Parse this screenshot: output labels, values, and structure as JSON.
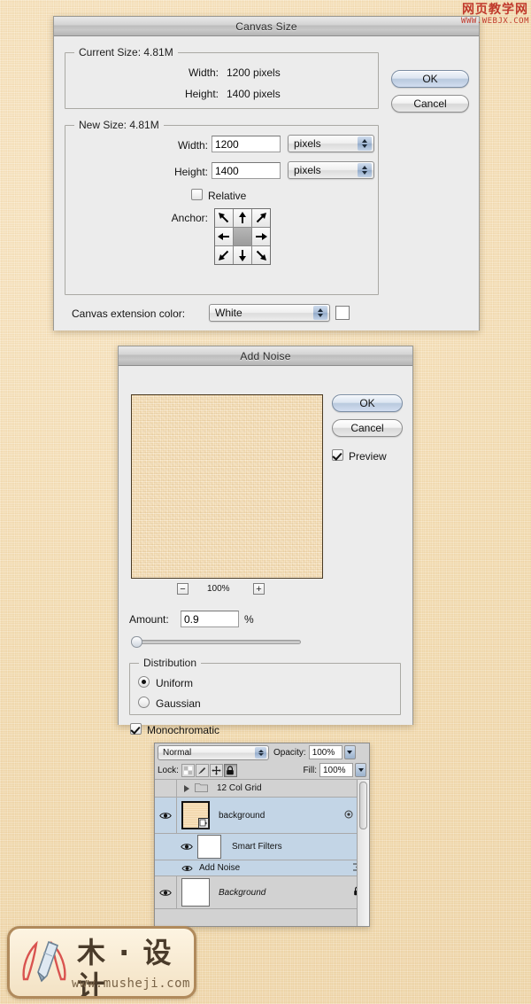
{
  "canvas_size_dialog": {
    "title": "Canvas Size",
    "current_size": {
      "legend": "Current Size: 4.81M",
      "width_label": "Width:",
      "width_value": "1200 pixels",
      "height_label": "Height:",
      "height_value": "1400 pixels"
    },
    "new_size": {
      "legend": "New Size: 4.81M",
      "width_label": "Width:",
      "width_value": "1200",
      "width_unit": "pixels",
      "height_label": "Height:",
      "height_value": "1400",
      "height_unit": "pixels",
      "relative_label": "Relative",
      "relative_checked": false,
      "anchor_label": "Anchor:"
    },
    "extension_color_label": "Canvas extension color:",
    "extension_color_value": "White",
    "extension_swatch_color": "#ffffff",
    "ok_label": "OK",
    "cancel_label": "Cancel"
  },
  "add_noise_dialog": {
    "title": "Add Noise",
    "ok_label": "OK",
    "cancel_label": "Cancel",
    "preview_label": "Preview",
    "preview_checked": true,
    "zoom_out_label": "−",
    "zoom_level": "100%",
    "zoom_in_label": "+",
    "amount_label": "Amount:",
    "amount_value": "0.9",
    "amount_unit": "%",
    "distribution_legend": "Distribution",
    "uniform_label": "Uniform",
    "uniform_selected": true,
    "gaussian_label": "Gaussian",
    "gaussian_selected": false,
    "monochromatic_label": "Monochromatic",
    "monochromatic_checked": true,
    "preview_swatch_color": "#f7dfb4"
  },
  "layers_panel": {
    "blend_mode": "Normal",
    "opacity_label": "Opacity:",
    "opacity_value": "100%",
    "lock_label": "Lock:",
    "fill_label": "Fill:",
    "fill_value": "100%",
    "lock_icons": [
      {
        "name": "lock-transparency-icon",
        "active": false
      },
      {
        "name": "lock-image-pixels-icon",
        "active": false
      },
      {
        "name": "lock-position-icon",
        "active": false
      },
      {
        "name": "lock-all-icon",
        "active": true
      }
    ],
    "rows": [
      {
        "type": "group",
        "name": "12 Col Grid",
        "visible": false,
        "expanded": false,
        "selected": false
      },
      {
        "type": "smart-object",
        "name": "background",
        "visible": true,
        "selected": true,
        "thumb_color": "#f7ddb1"
      },
      {
        "type": "smart-filters",
        "name": "Smart Filters",
        "visible": true,
        "selected": true,
        "thumb_color": "#ffffff"
      },
      {
        "type": "filter",
        "name": "Add Noise",
        "visible": true,
        "selected": true
      },
      {
        "type": "layer",
        "name": "Background",
        "visible": true,
        "selected": false,
        "locked": true,
        "thumb_color": "#ffffff"
      }
    ]
  },
  "watermark_top": {
    "chinese": "网页教学网",
    "url": "WWW.WEBJX.COM",
    "color": "#c0392b"
  },
  "logo_bottom": {
    "chinese": "木 · 设计",
    "url": "www.musheji.com"
  }
}
